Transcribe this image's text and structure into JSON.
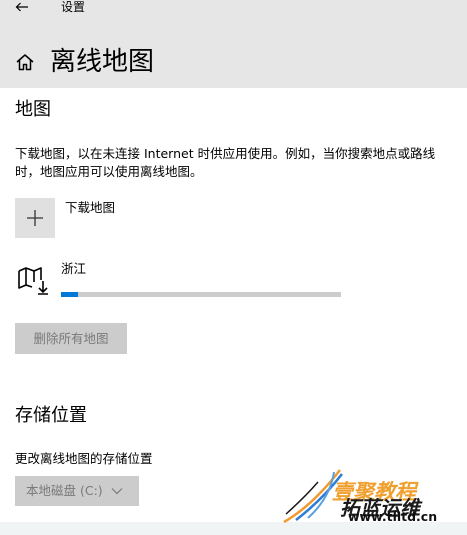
{
  "window": {
    "title": "设置"
  },
  "page": {
    "title": "离线地图"
  },
  "maps_section": {
    "heading": "地图",
    "description": "下载地图，以在未连接 Internet 时供应用使用。例如，当你搜索地点或路线时，地图应用可以使用离线地图。",
    "download_label": "下载地图",
    "downloaded_map": {
      "name": "浙江",
      "progress_percent": 6
    },
    "delete_all_label": "删除所有地图"
  },
  "storage_section": {
    "heading": "存储位置",
    "change_label": "更改离线地图的存储位置",
    "selected_drive": "本地磁盘 (C:)"
  },
  "watermark": {
    "line1": "壹聚教程",
    "line2": "拓蓝运维",
    "url": "www.tlltd.cn"
  },
  "colors": {
    "accent": "#0078d7",
    "titlebar_bg": "#e6e6e6",
    "disabled_bg": "#cccccc",
    "disabled_text": "#7a7a7a"
  },
  "icons": {
    "back": "back-arrow-icon",
    "home": "home-icon",
    "add": "plus-icon",
    "map": "map-download-icon",
    "dropdown": "chevron-down-icon"
  }
}
